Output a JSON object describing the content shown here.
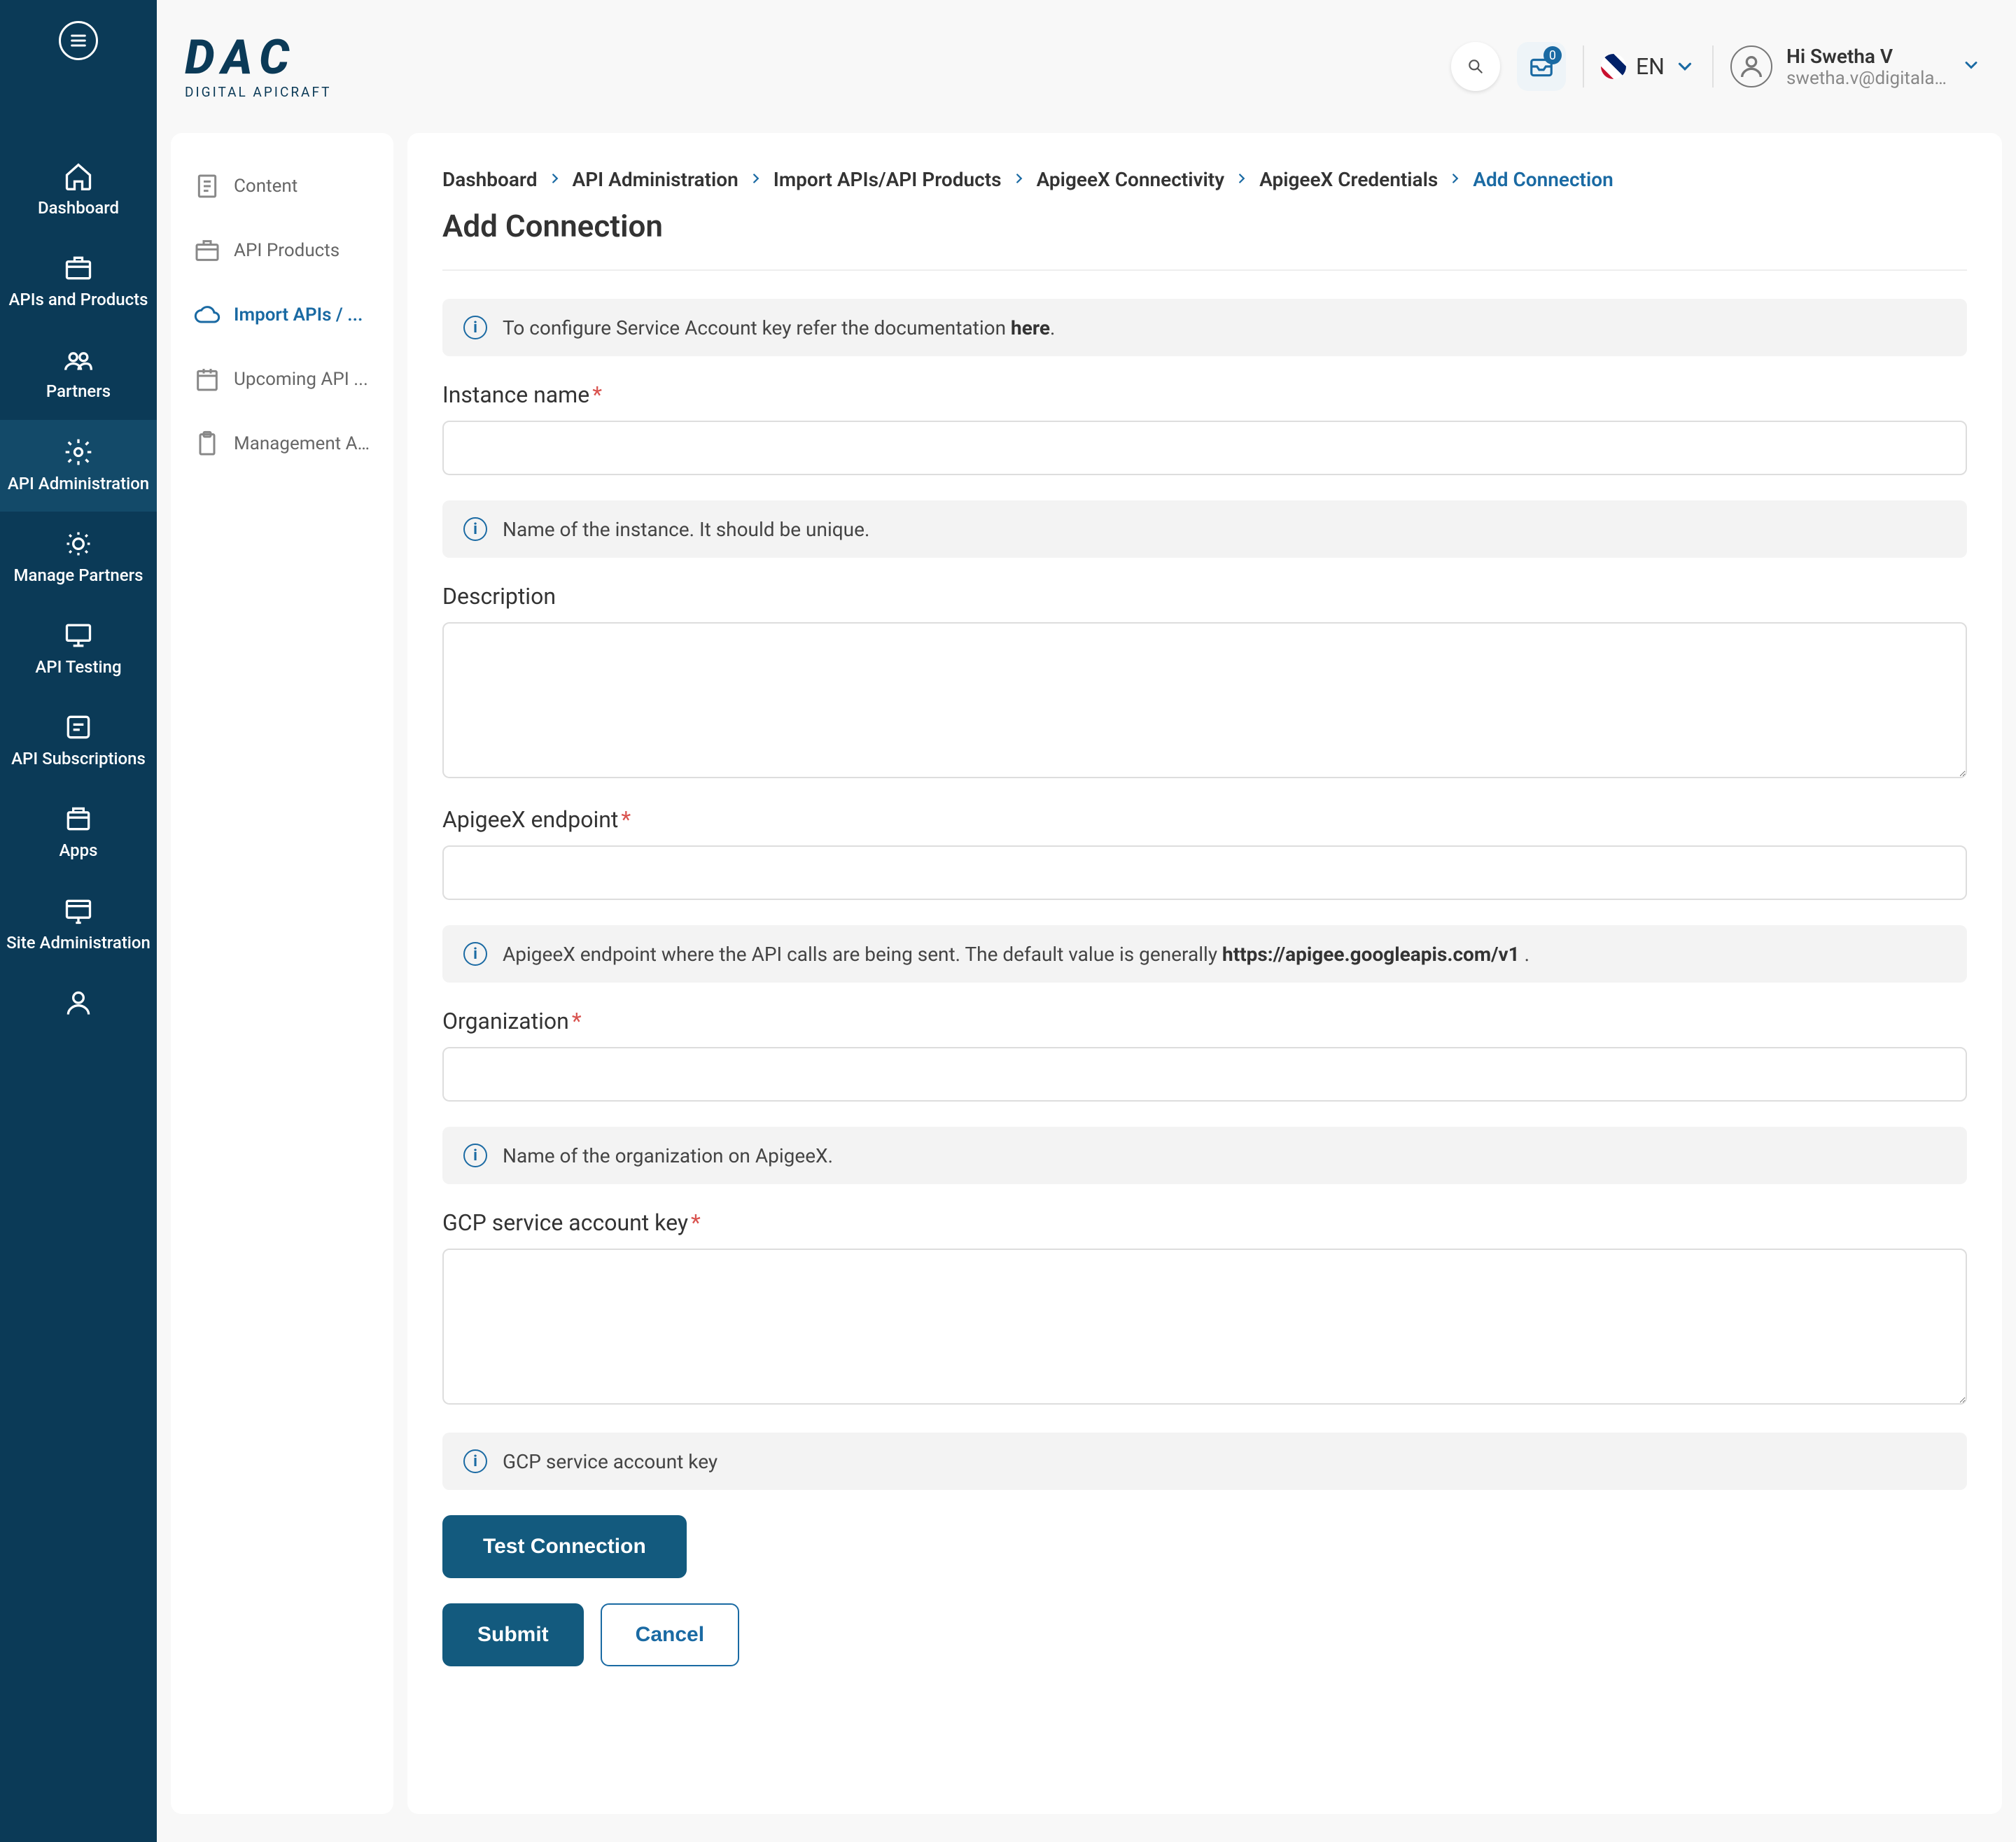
{
  "brand": {
    "name": "DAC",
    "tagline": "DIGITAL APICRAFT"
  },
  "header": {
    "notif_count": "0",
    "lang": "EN",
    "user_greeting": "Hi Swetha V",
    "user_email": "swetha.v@digitala..."
  },
  "primaryNav": [
    {
      "label": "Dashboard",
      "icon": "home"
    },
    {
      "label": "APIs and Products",
      "icon": "box"
    },
    {
      "label": "Partners",
      "icon": "group"
    },
    {
      "label": "API Administration",
      "icon": "gear",
      "active": true
    },
    {
      "label": "Manage Partners",
      "icon": "gear2"
    },
    {
      "label": "API Testing",
      "icon": "monitor"
    },
    {
      "label": "API Subscriptions",
      "icon": "sub"
    },
    {
      "label": "Apps",
      "icon": "apps"
    },
    {
      "label": "Site Administration",
      "icon": "site"
    },
    {
      "label": "",
      "icon": "person"
    }
  ],
  "subNav": [
    {
      "label": "Content"
    },
    {
      "label": "API Products"
    },
    {
      "label": "Import APIs / ...",
      "active": true
    },
    {
      "label": "Upcoming API ..."
    },
    {
      "label": "Management A..."
    }
  ],
  "breadcrumb": [
    "Dashboard",
    "API Administration",
    "Import APIs/API Products",
    "ApigeeX Connectivity",
    "ApigeeX Credentials"
  ],
  "breadcrumb_current": "Add Connection",
  "page_title": "Add Connection",
  "info_top_prefix": "To configure Service Account key refer the documentation ",
  "info_top_link": "here",
  "info_top_suffix": ".",
  "fields": {
    "instance_name": {
      "label": "Instance name",
      "hint": "Name of the instance. It should be unique."
    },
    "description": {
      "label": "Description"
    },
    "apigeex_endpoint": {
      "label": "ApigeeX endpoint",
      "hint_prefix": "ApigeeX endpoint where the API calls are being sent. The default value is generally  ",
      "hint_bold": "https://apigee.googleapis.com/v1",
      "hint_suffix": " ."
    },
    "organization": {
      "label": "Organization",
      "hint": "Name of the organization on ApigeeX."
    },
    "gcp_key": {
      "label": "GCP service account key",
      "hint": "GCP service account key"
    }
  },
  "buttons": {
    "test": "Test Connection",
    "submit": "Submit",
    "cancel": "Cancel"
  }
}
